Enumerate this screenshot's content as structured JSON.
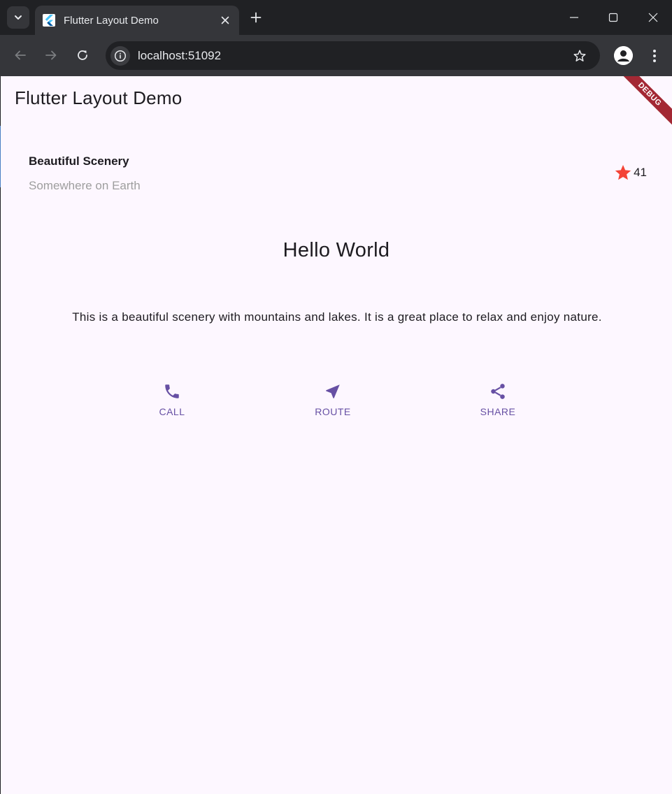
{
  "browser": {
    "tab_title": "Flutter Layout Demo",
    "url": "localhost:51092"
  },
  "app": {
    "title": "Flutter Layout Demo",
    "debug_label": "DEBUG"
  },
  "title_section": {
    "name": "Beautiful Scenery",
    "location": "Somewhere on Earth",
    "rating_count": "41"
  },
  "heading": "Hello World",
  "description": "This is a beautiful scenery with mountains and lakes. It is a great place to relax and enjoy nature.",
  "actions": [
    {
      "label": "CALL",
      "icon": "phone-icon"
    },
    {
      "label": "ROUTE",
      "icon": "near-me-icon"
    },
    {
      "label": "SHARE",
      "icon": "share-icon"
    }
  ],
  "colors": {
    "accent": "#6750a4",
    "star": "#f44336",
    "background": "#fdf7ff",
    "browser_frame": "#202124",
    "browser_toolbar": "#35363a"
  }
}
